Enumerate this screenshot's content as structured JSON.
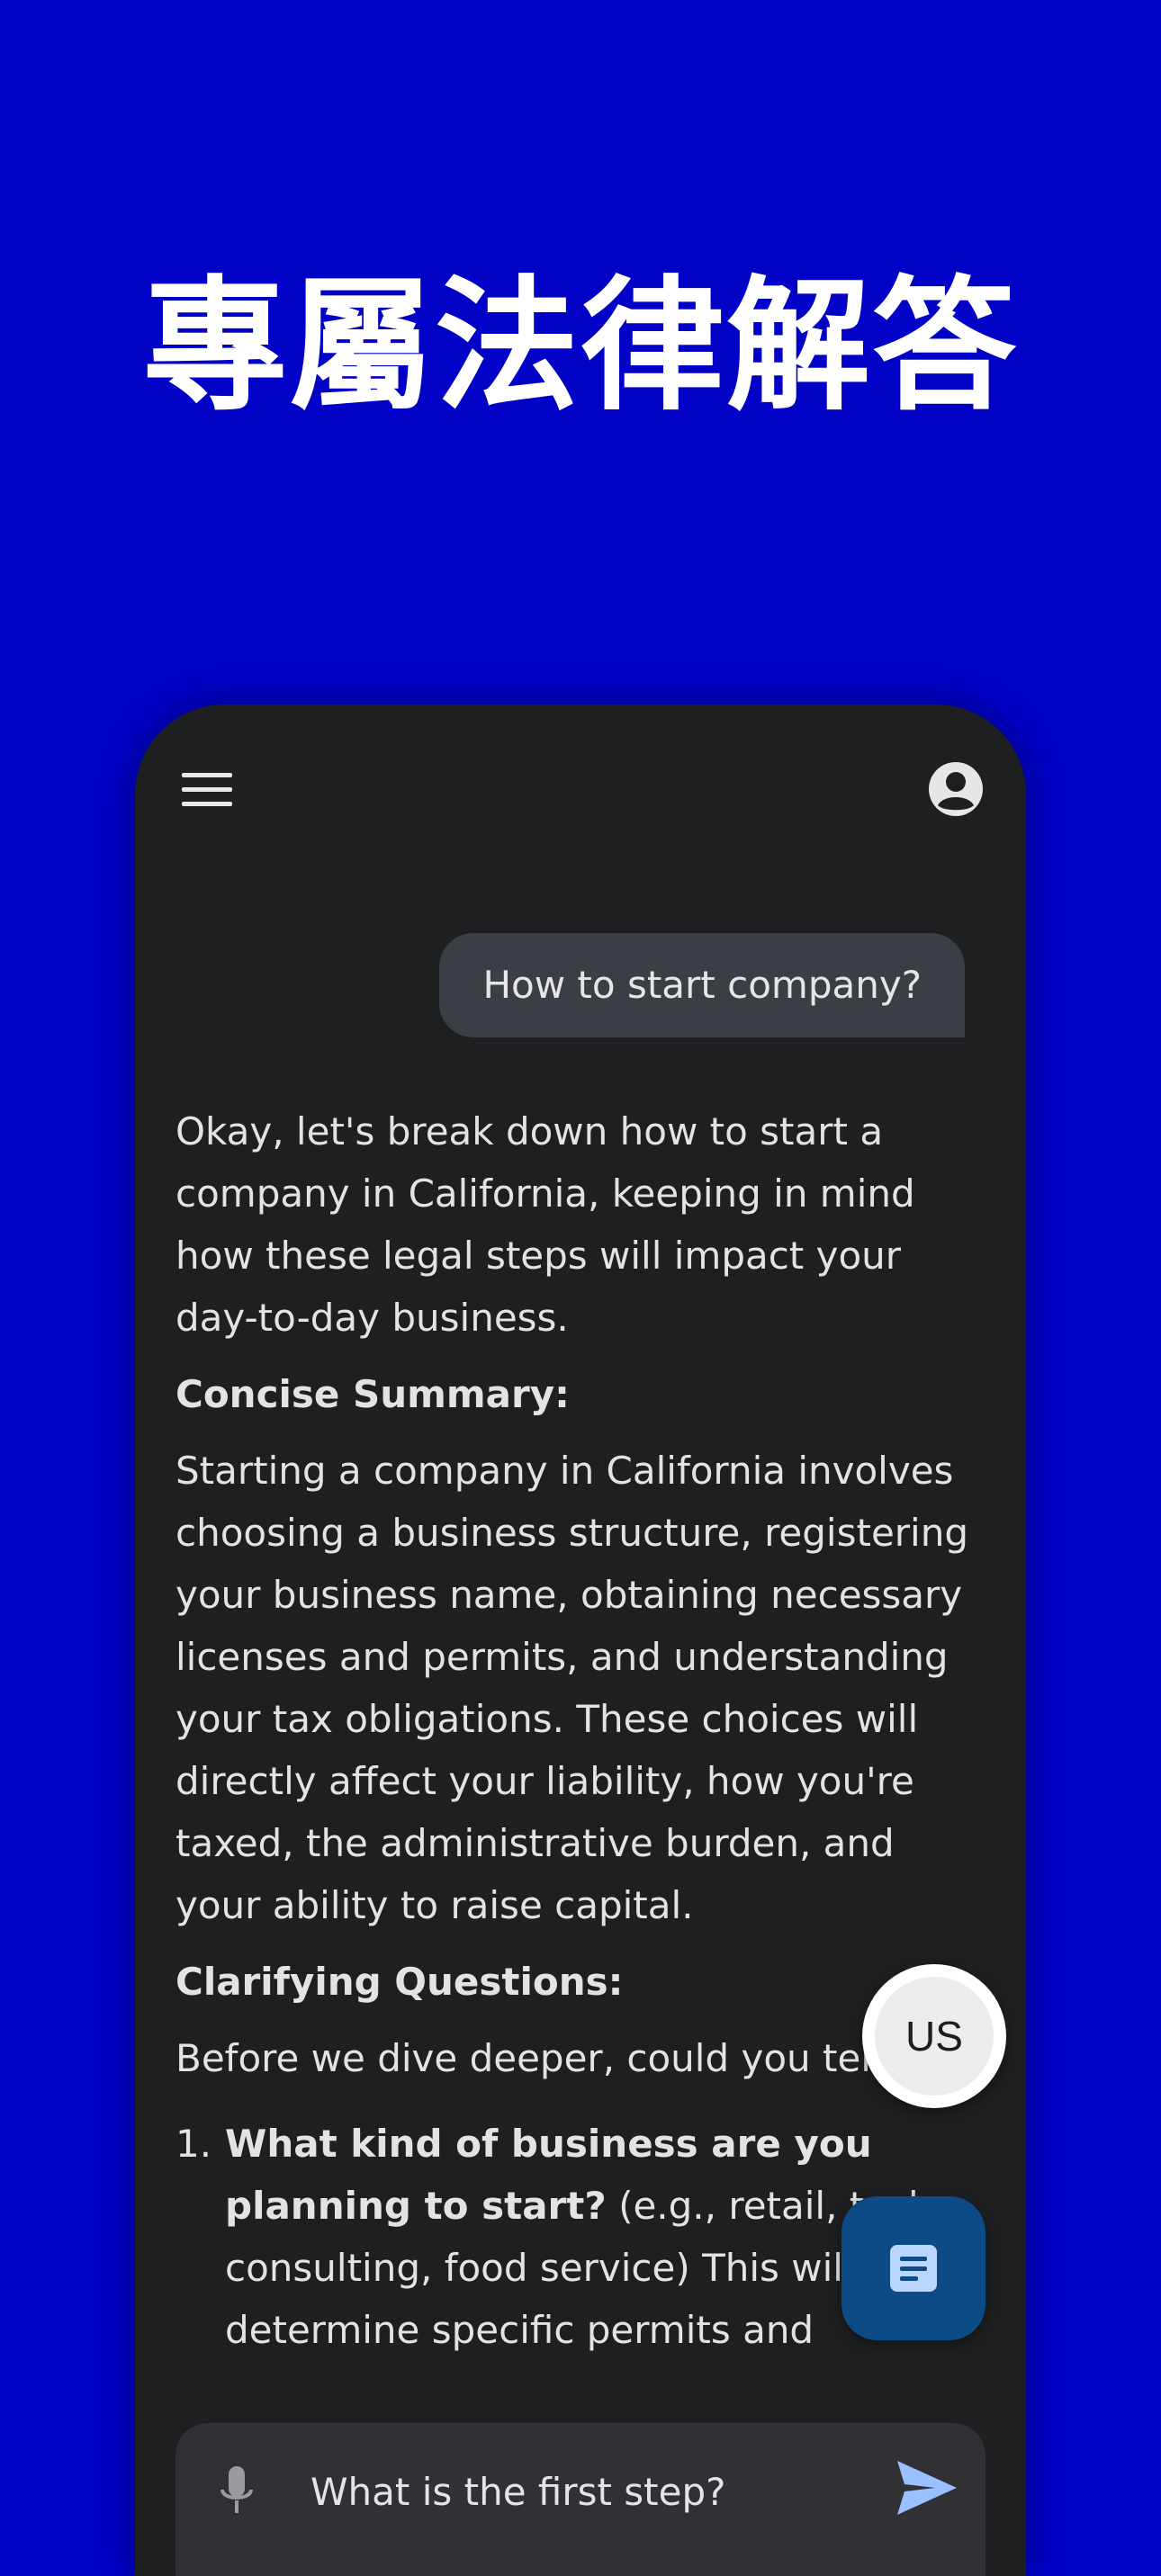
{
  "headline": "專屬法律解答",
  "chat": {
    "user_message": "How to start company?",
    "answer_intro": "Okay, let's break down how to start a company in California, keeping in mind how these legal steps will impact your day-to-day business.",
    "summary_heading": "Concise Summary:",
    "summary_text": "Starting a company in California involves choosing a business structure, registering your business name, obtaining necessary licenses and permits, and understanding your tax obligations. These choices will directly affect your liability, how you're taxed, the administrative burden, and your ability to raise capital.",
    "questions_heading": "Clarifying Questions:",
    "questions_intro": "Before we dive deeper, could you tell me:",
    "questions": [
      {
        "number": "1.",
        "bold": "What kind of business are you planning to start?",
        "rest": " (e.g., retail, tech, consulting, food service) This will help determine specific permits and"
      }
    ]
  },
  "fab": {
    "region_label": "US",
    "doc_icon": "document-icon"
  },
  "input": {
    "value": "What is the first step?"
  },
  "icons": {
    "menu": "menu-icon",
    "profile": "account-circle-icon",
    "mic": "microphone-icon",
    "send": "send-icon"
  },
  "colors": {
    "background": "#0202c6",
    "phone": "#1e1f21",
    "bubble": "#3b3f45",
    "doc_fab": "#0c4b86",
    "send": "#9bc0ff"
  }
}
